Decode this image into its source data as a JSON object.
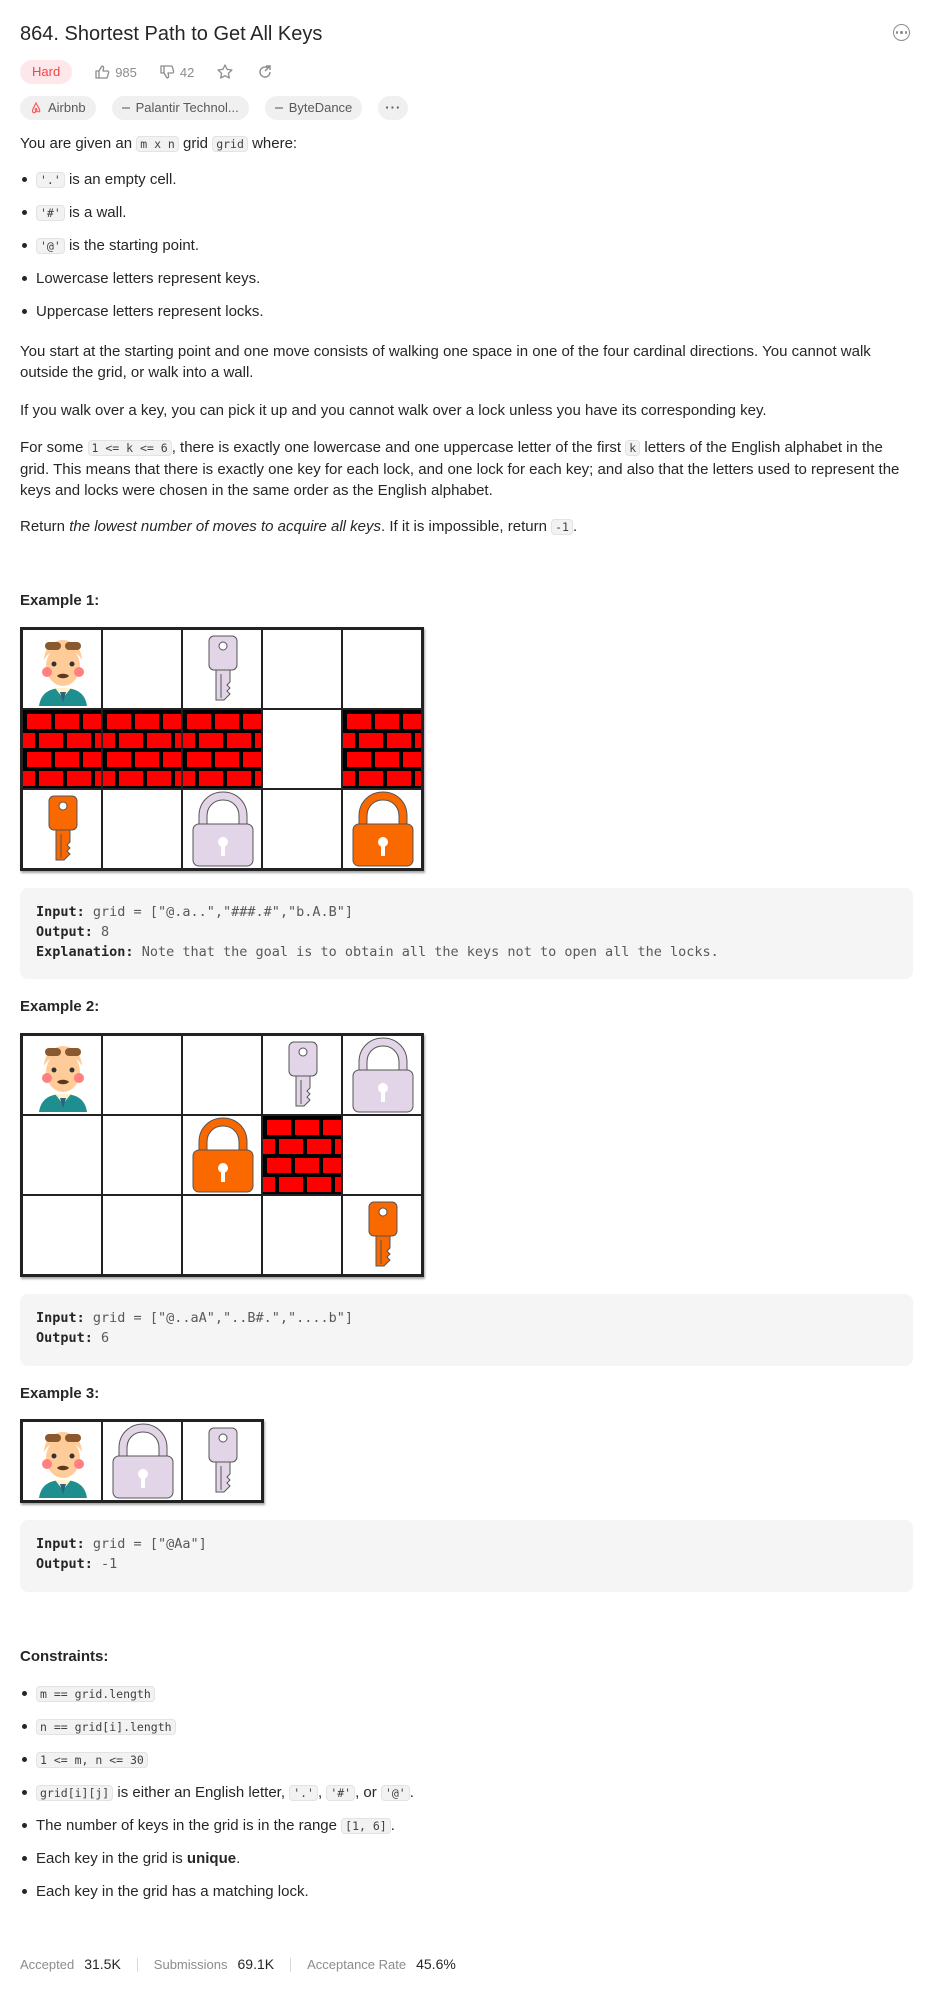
{
  "problem": {
    "title": "864. Shortest Path to Get All Keys",
    "difficulty": "Hard",
    "likes": "985",
    "dislikes": "42"
  },
  "tags": [
    "Airbnb",
    "Palantir Technol...",
    "ByteDance",
    "···"
  ],
  "description": {
    "p1_pre": "You are given an ",
    "p1_code1": "m x n",
    "p1_mid": " grid ",
    "p1_code2": "grid",
    "p1_post": " where:",
    "bullets": [
      {
        "code": "'.'",
        "text": " is an empty cell."
      },
      {
        "code": "'#'",
        "text": " is a wall."
      },
      {
        "code": "'@'",
        "text": " is the starting point."
      },
      {
        "code": "",
        "text": "Lowercase letters represent keys."
      },
      {
        "code": "",
        "text": "Uppercase letters represent locks."
      }
    ],
    "p2": "You start at the starting point and one move consists of walking one space in one of the four cardinal directions. You cannot walk outside the grid, or walk into a wall.",
    "p3": "If you walk over a key, you can pick it up and you cannot walk over a lock unless you have its corresponding key.",
    "p4_pre": "For some ",
    "p4_code1": "1 <= k <= 6",
    "p4_mid": ", there is exactly one lowercase and one uppercase letter of the first ",
    "p4_code2": "k",
    "p4_post": " letters of the English alphabet in the grid. This means that there is exactly one key for each lock, and one lock for each key; and also that the letters used to represent the keys and locks were chosen in the same order as the English alphabet.",
    "p5_pre": "Return ",
    "p5_em": "the lowest number of moves to acquire all keys",
    "p5_mid": ". If it is impossible, return ",
    "p5_code": "-1",
    "p5_post": "."
  },
  "examples": [
    {
      "title": "Example 1:",
      "grid": [
        "@.a..",
        "###.#",
        "b.A.B"
      ],
      "input_label": "Input:",
      "input": "grid = [\"@.a..\",\"###.#\",\"b.A.B\"]",
      "output_label": "Output:",
      "output": "8",
      "explanation_label": "Explanation:",
      "explanation": "Note that the goal is to obtain all the keys not to open all the locks."
    },
    {
      "title": "Example 2:",
      "grid": [
        "@..aA",
        "..B#.",
        "....b"
      ],
      "input_label": "Input:",
      "input": "grid = [\"@..aA\",\"..B#.\",\"....b\"]",
      "output_label": "Output:",
      "output": "6"
    },
    {
      "title": "Example 3:",
      "grid": [
        "@Aa"
      ],
      "input_label": "Input:",
      "input": "grid = [\"@Aa\"]",
      "output_label": "Output:",
      "output": "-1"
    }
  ],
  "constraints": {
    "title": "Constraints:",
    "items": [
      {
        "code": "m == grid.length",
        "text": ""
      },
      {
        "code": "n == grid[i].length",
        "text": ""
      },
      {
        "code": "1 <= m, n <= 30",
        "text": ""
      },
      {
        "code": "grid[i][j]",
        "text": " is either an English letter, ",
        "c2": "'.'",
        "t2": ", ",
        "c3": "'#'",
        "t3": ", or ",
        "c4": "'@'",
        "t4": "."
      },
      {
        "code": "",
        "text": "The number of keys in the grid is in the range ",
        "c2": "[1, 6]",
        "t2": "."
      },
      {
        "code": "",
        "text": "Each key in the grid is ",
        "strong": "unique",
        "t2": "."
      },
      {
        "code": "",
        "text": "Each key in the grid has a matching lock."
      }
    ]
  },
  "stats": {
    "accepted_label": "Accepted",
    "accepted": "31.5K",
    "submissions_label": "Submissions",
    "submissions": "69.1K",
    "rate_label": "Acceptance Rate",
    "rate": "45.6%"
  },
  "colors": {
    "hard": "#ef4743",
    "wall_brick": "#ff0000",
    "key_a": "#e1d5e7",
    "key_b": "#fa6800"
  }
}
